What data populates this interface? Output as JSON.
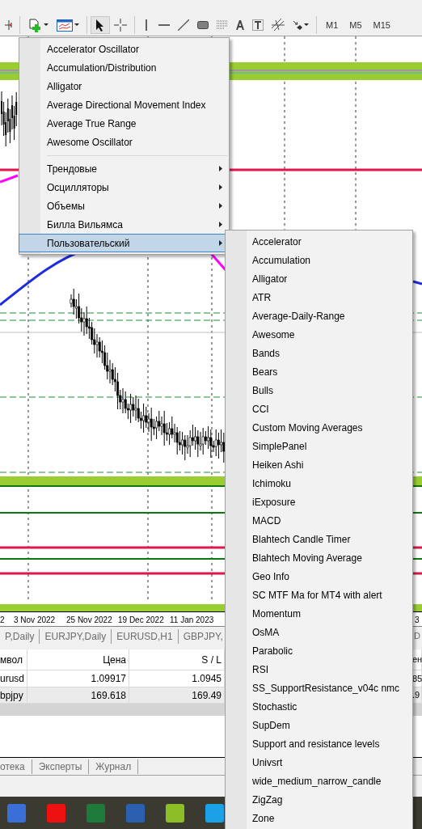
{
  "toolbar": {
    "periods": [
      "M1",
      "M5",
      "M15"
    ]
  },
  "chart": {
    "date_labels": [
      "2",
      "3 Nov 2022",
      "25 Nov 2022",
      "19 Dec 2022",
      "11 Jan 2023",
      "3"
    ]
  },
  "chart_tabs": [
    "P,Daily",
    "EURJPY,Daily",
    "EURUSD,H1",
    "GBPJPY,",
    "D"
  ],
  "trade_table": {
    "columns": [
      "мвол",
      "Цена",
      "S / L",
      "ен"
    ],
    "rows": [
      [
        "urusd",
        "1.09917",
        "1.0945",
        "85"
      ],
      [
        "bpjpy",
        "169.618",
        "169.49",
        ".9"
      ]
    ]
  },
  "terminal_tabs": [
    "отека",
    "Эксперты",
    "Журнал"
  ],
  "indicators_menu": {
    "items": [
      "Accelerator Oscillator",
      "Accumulation/Distribution",
      "Alligator",
      "Average Directional Movement Index",
      "Average True Range",
      "Awesome Oscillator"
    ],
    "groups": [
      {
        "label": "Трендовые",
        "selected": false
      },
      {
        "label": "Осцилляторы",
        "selected": false
      },
      {
        "label": "Объемы",
        "selected": false
      },
      {
        "label": "Билла Вильямса",
        "selected": false
      },
      {
        "label": "Пользовательский",
        "selected": true
      }
    ]
  },
  "custom_submenu": {
    "items": [
      "Accelerator",
      "Accumulation",
      "Alligator",
      "ATR",
      "Average-Daily-Range",
      "Awesome",
      "Bands",
      "Bears",
      "Bulls",
      "CCI",
      "Custom Moving Averages",
      "SimplePanel",
      "Heiken Ashi",
      "Ichimoku",
      "iExposure",
      "MACD",
      "Blahtech Candle Timer",
      "Blahtech Moving Average",
      "Geo Info",
      "SC MTF Ma for MT4 with alert",
      "Momentum",
      "OsMA",
      "Parabolic",
      "RSI",
      "SS_SupportResistance_v04c nmc",
      "Stochastic",
      "SupDem",
      "Support and resistance levels",
      "Univsrt",
      "wide_medium_narrow_candle",
      "ZigZag",
      "Zone"
    ]
  }
}
